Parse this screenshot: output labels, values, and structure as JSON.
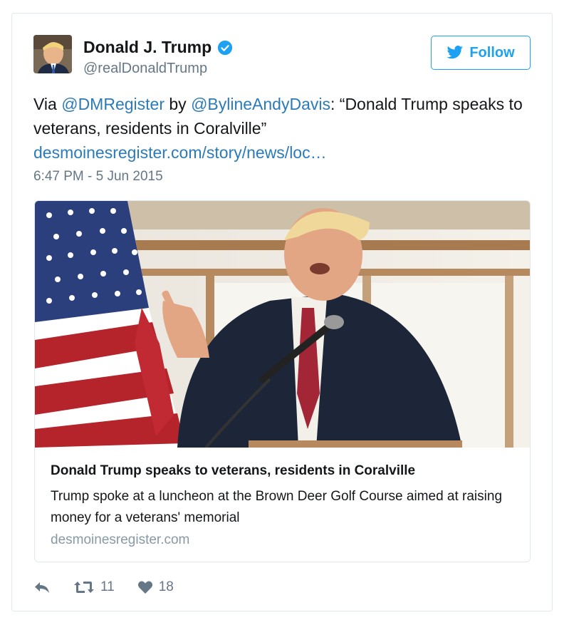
{
  "user": {
    "display_name": "Donald J. Trump",
    "handle": "@realDonaldTrump",
    "verified": true
  },
  "follow_button": {
    "label": "Follow"
  },
  "tweet": {
    "prefix": "Via ",
    "mention1": "@DMRegister",
    "middle": " by ",
    "mention2": "@BylineAndyDavis",
    "quote": ": “Donald Trump speaks to veterans, residents in Coralville”",
    "link": "desmoinesregister.com/story/news/loc…",
    "timestamp": "6:47 PM - 5 Jun 2015"
  },
  "link_card": {
    "title": "Donald Trump speaks to veterans, residents in Coralville",
    "description": "Trump spoke at a luncheon at the Brown Deer Golf Course aimed at raising money for a veterans' memorial",
    "domain": "desmoinesregister.com"
  },
  "actions": {
    "retweet_count": "11",
    "like_count": "18"
  },
  "colors": {
    "accent": "#1da1f2",
    "link": "#2b7bb9",
    "muted": "#657786"
  }
}
